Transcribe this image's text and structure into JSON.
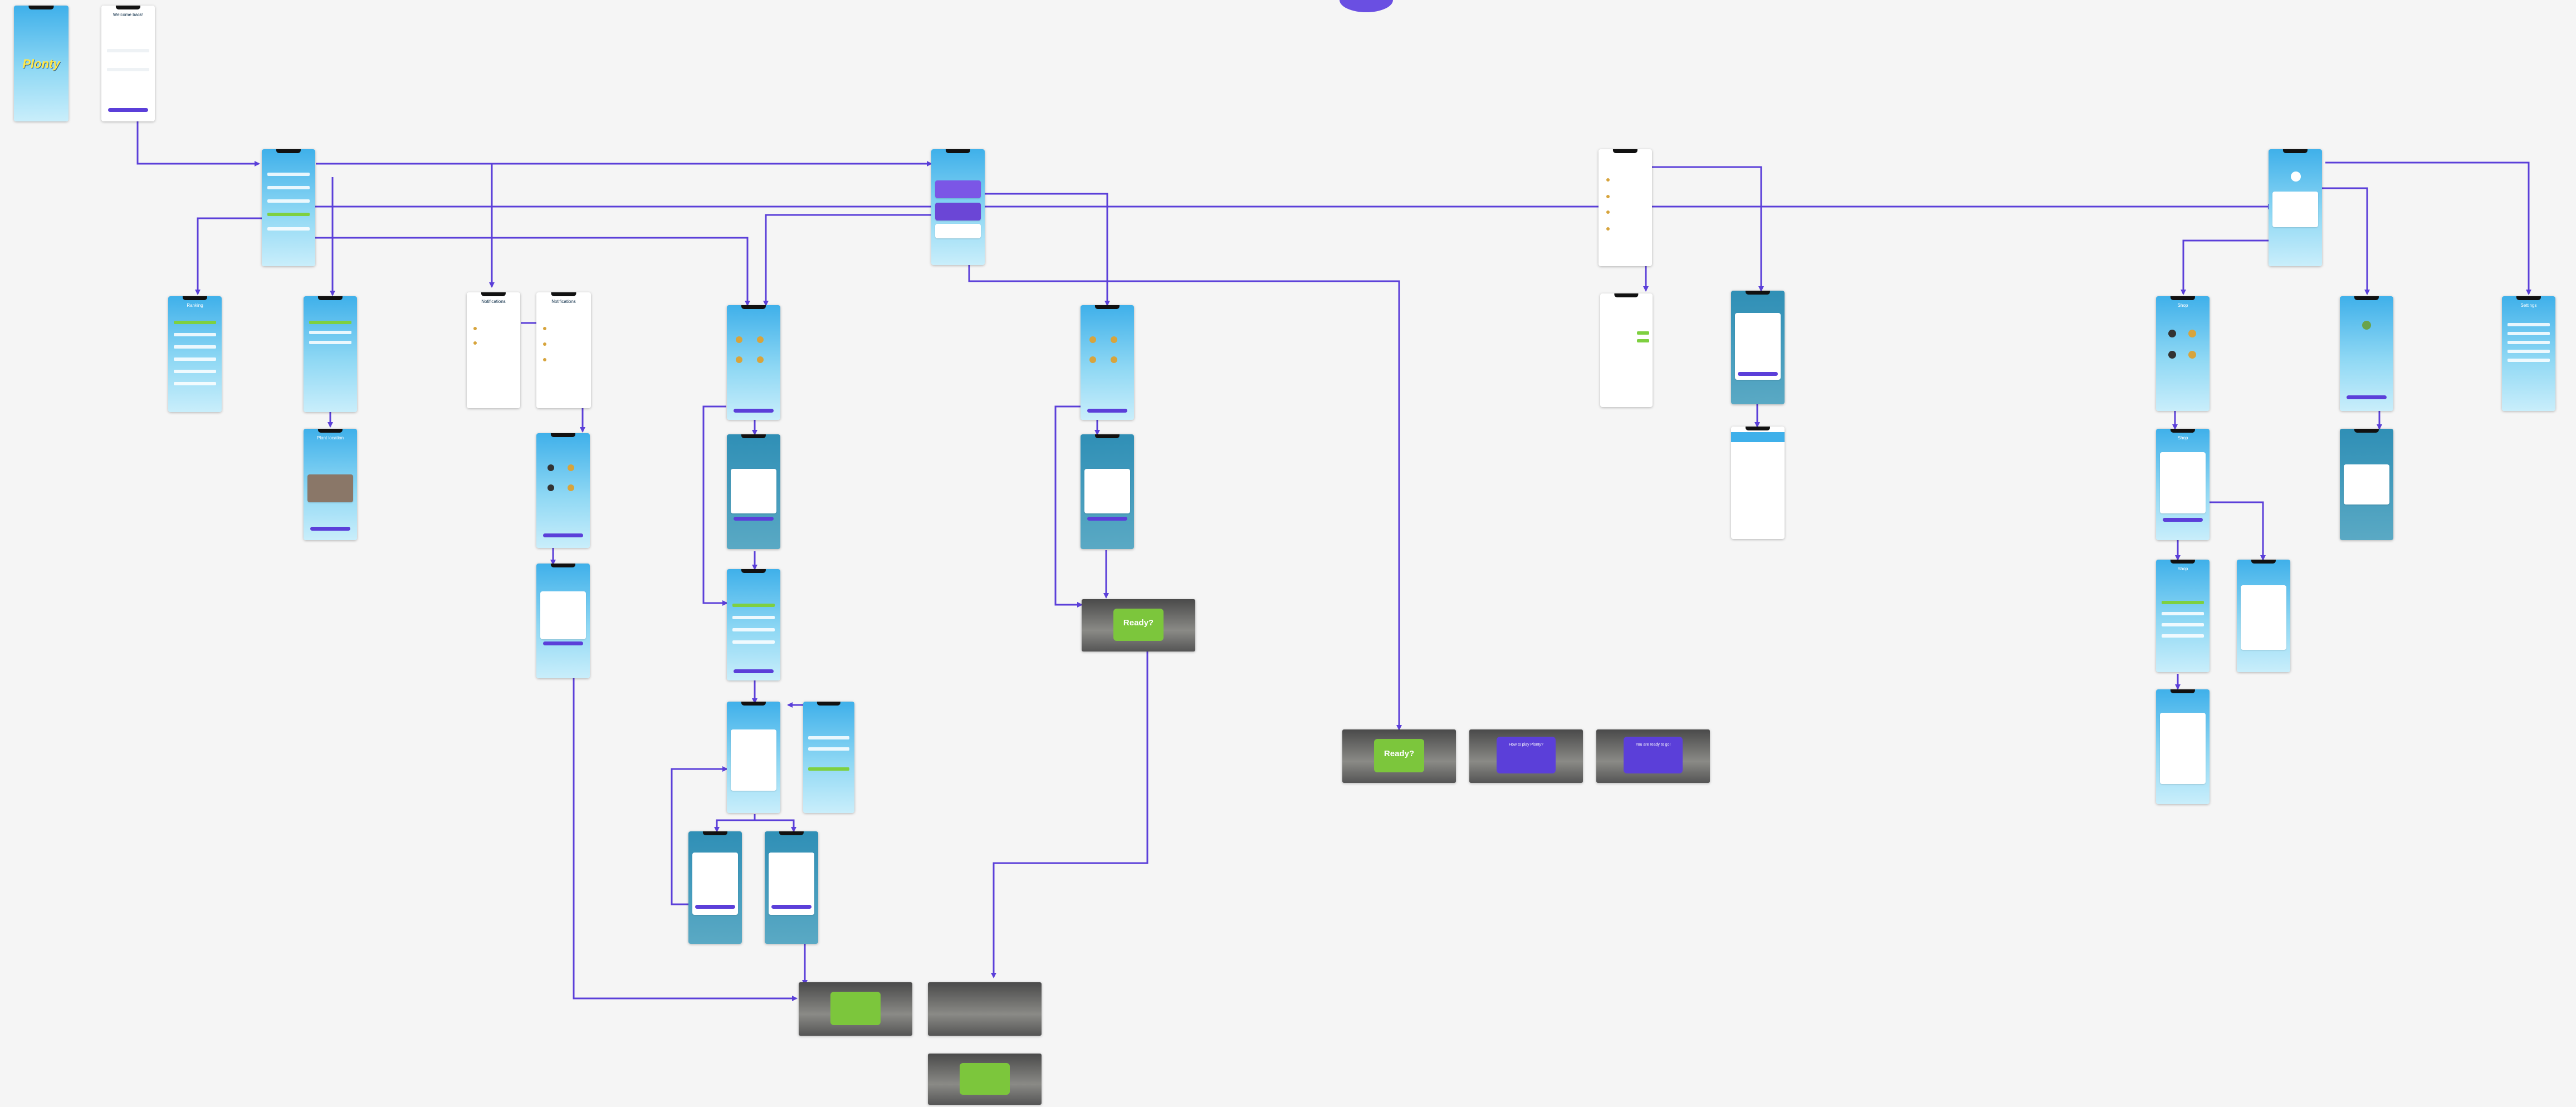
{
  "colors": {
    "connector": "#5b3fd9",
    "background": "#f5f5f5",
    "phone_gradient_top": "#3fb0ea",
    "button": "#5b3fd9",
    "accent_green": "#7ed040",
    "logo": "#ffe84a"
  },
  "screens": {
    "splash": {
      "logo": "Plonty"
    },
    "login": {
      "title": "Welcome back!"
    },
    "list_home": {
      "title": ""
    },
    "home_center": {
      "title": ""
    },
    "home_right": {
      "title": ""
    },
    "home_far_right": {
      "title": ""
    },
    "ranking": {
      "title": "Ranking"
    },
    "plant_detail_a": {
      "title": ""
    },
    "plant_map": {
      "title": "Plant location"
    },
    "notifications_a": {
      "title": "Notifications"
    },
    "notifications_b": {
      "title": "Notifications"
    },
    "select_plant_a": {
      "title": ""
    },
    "select_plant_b": {
      "title": ""
    },
    "plant_pick_c": {
      "title": ""
    },
    "plant_pick_d": {
      "title": ""
    },
    "select_list_c": {
      "title": ""
    },
    "game_loss": {
      "title": ""
    },
    "game_win": {
      "title": ""
    },
    "chat": {
      "title": ""
    },
    "chat_list": {
      "title": ""
    },
    "chat_blank": {
      "title": ""
    },
    "shop": {
      "title": "Shop"
    },
    "shop_item": {
      "title": "Shop"
    },
    "shop_list": {
      "title": "Shop"
    },
    "shop_result": {
      "title": "Shop"
    },
    "shop_congrats": {
      "title": "Congratulations"
    },
    "garden": {
      "title": ""
    },
    "garden_popup": {
      "title": ""
    },
    "settings": {
      "title": "Settings"
    }
  },
  "landscape": {
    "ready_b": {
      "text": "Ready?"
    },
    "ready_center": {
      "text": "Ready?"
    },
    "how_to_play": {
      "text": "How to play Plonty?"
    },
    "you_are_ready": {
      "text": "You are ready to go!"
    }
  }
}
